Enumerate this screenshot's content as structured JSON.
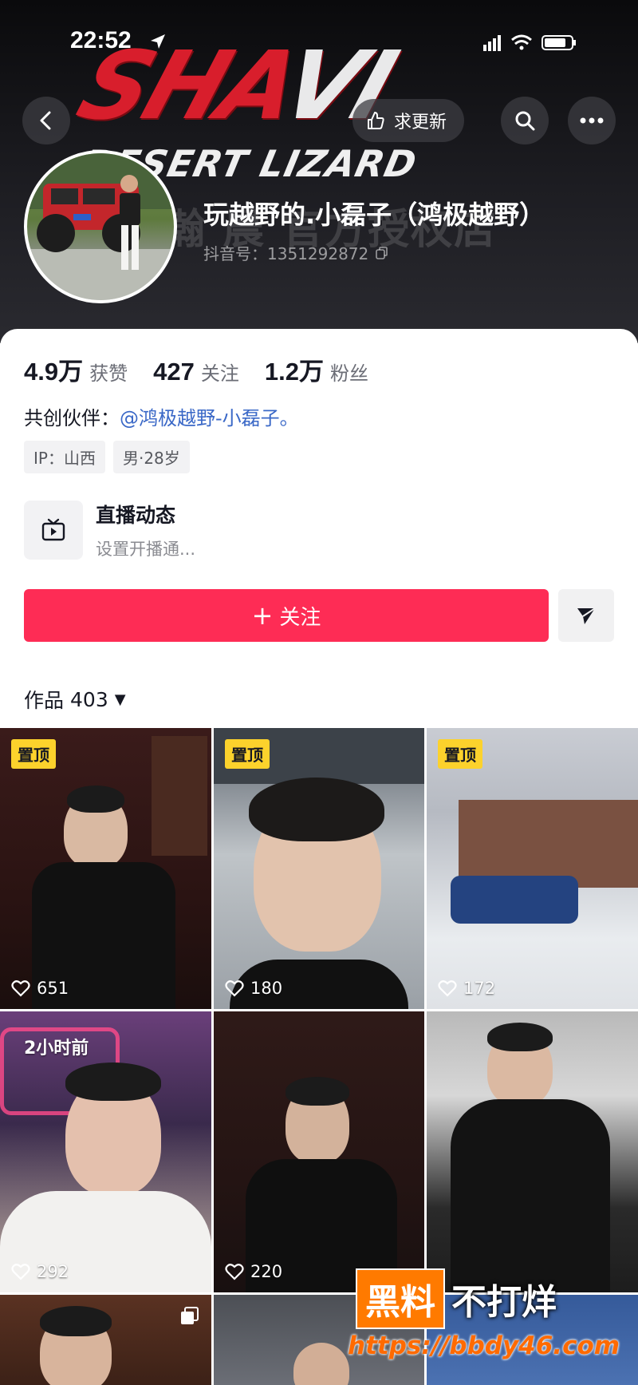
{
  "status_bar": {
    "time": "22:52"
  },
  "banner": {
    "logo_main": "SHA",
    "logo_main_hl": "VI",
    "logo_sub": "DESERT LIZARD",
    "watermark": "瀚 晨 官方授权店"
  },
  "nav": {
    "update_label": "求更新"
  },
  "profile": {
    "name": "玩越野的.小磊子（鸿极越野）",
    "douyin_id": "抖音号：1351292872"
  },
  "stats": [
    {
      "num": "4.9万",
      "label": "获赞"
    },
    {
      "num": "427",
      "label": "关注"
    },
    {
      "num": "1.2万",
      "label": "粉丝"
    }
  ],
  "partner": {
    "label": "共创伙伴：",
    "link": "@鸿极越野-小磊子。"
  },
  "tags": [
    "IP：山西",
    "男·28岁"
  ],
  "live": {
    "title": "直播动态",
    "sub": "设置开播通..."
  },
  "follow_label": "关注",
  "works": {
    "label": "作品",
    "count": "403"
  },
  "videos": [
    {
      "pin": "置顶",
      "likes": "651"
    },
    {
      "pin": "置顶",
      "likes": "180"
    },
    {
      "pin": "置顶",
      "likes": "172"
    },
    {
      "badge": "2小时前",
      "likes": "292"
    },
    {
      "likes": "220"
    },
    {
      "likes": ""
    }
  ],
  "watermark": {
    "w1": "黑料",
    "w2": "不打烊",
    "url": "https://bbdy46.com"
  },
  "colors": {
    "accent": "#fe2c55",
    "pin": "#fcd22c",
    "link": "#3a68c7"
  }
}
